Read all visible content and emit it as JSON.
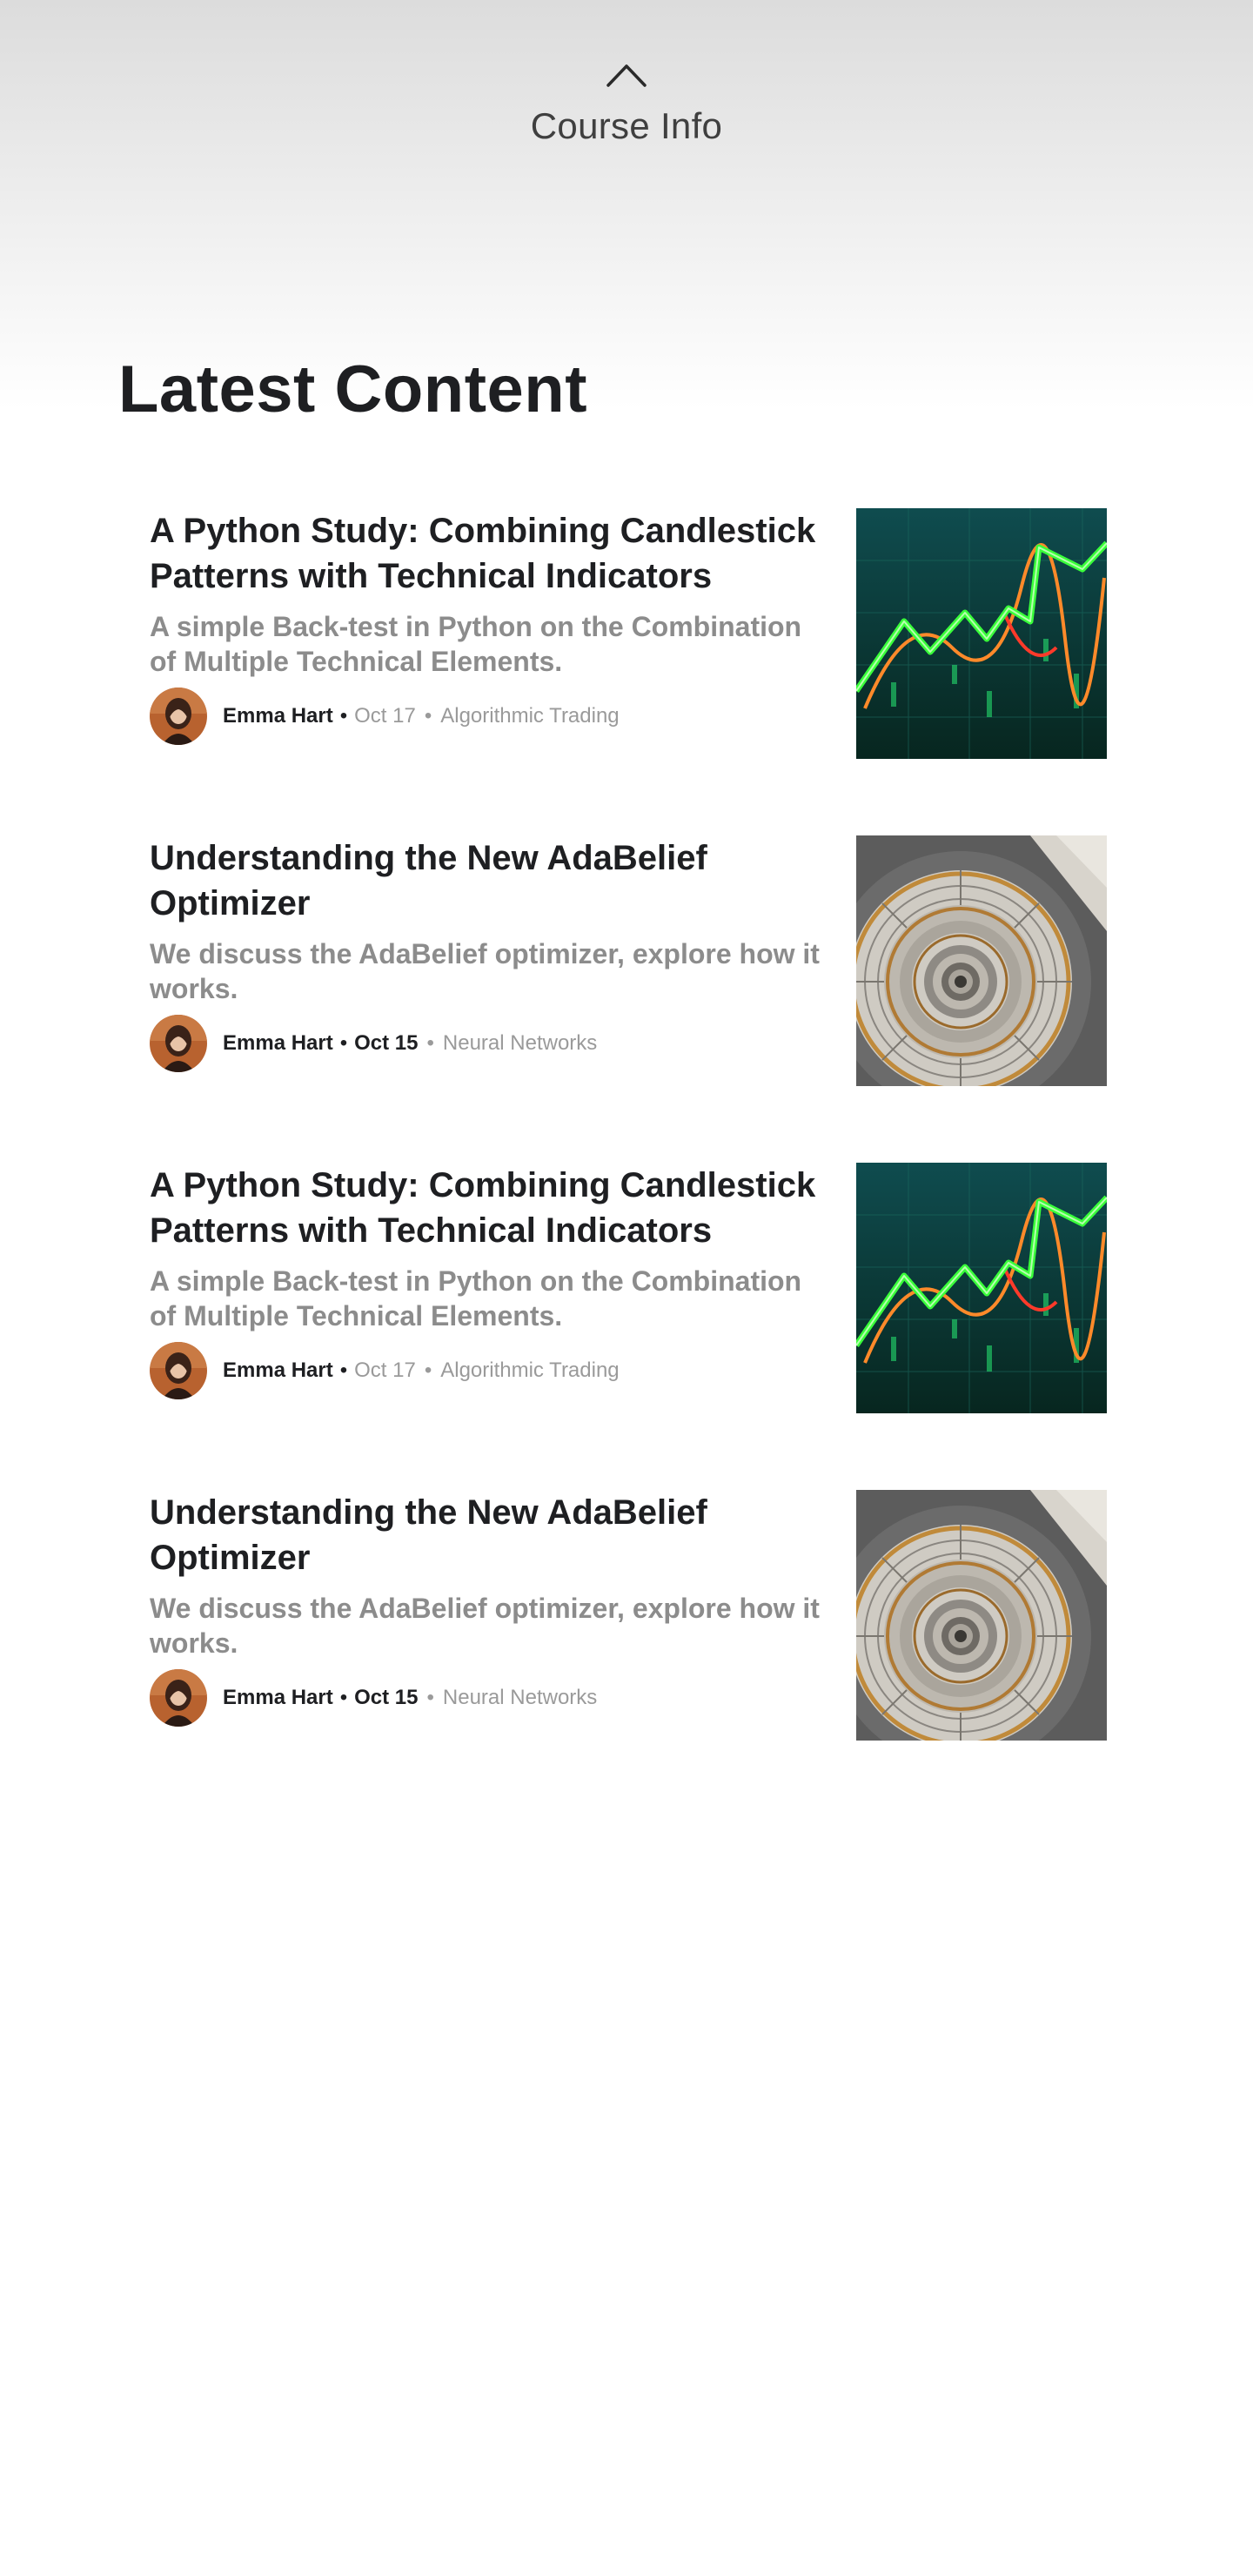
{
  "header": {
    "chevron_icon": "chevron-up-icon",
    "course_info_label": "Course Info"
  },
  "section": {
    "title": "Latest Content"
  },
  "articles": [
    {
      "title": "A Python Study: Combining Candlestick Patterns with Technical Indicators",
      "subtitle": "A simple Back-test in Python on the Combination of Multiple Technical Elements.",
      "author": "Emma Hart",
      "date": "Oct 17",
      "category": "Algorithmic Trading",
      "thumbnail": "stock-chart-thumbnail"
    },
    {
      "title": "Understanding the New AdaBelief Optimizer",
      "subtitle": "We discuss the AdaBelief optimizer, explore how it works.",
      "author": "Emma Hart",
      "date": "Oct 15",
      "category": "Neural Networks",
      "thumbnail": "spiral-staircase-thumbnail"
    },
    {
      "title": "A Python Study: Combining Candlestick Patterns with Technical Indicators",
      "subtitle": "A simple Back-test in Python on the Combination of Multiple Technical Elements.",
      "author": "Emma Hart",
      "date": "Oct 17",
      "category": "Algorithmic Trading",
      "thumbnail": "stock-chart-thumbnail"
    },
    {
      "title": "Understanding the New AdaBelief Optimizer",
      "subtitle": "We discuss the AdaBelief optimizer, explore how it works.",
      "author": "Emma Hart",
      "date": "Oct 15",
      "category": "Neural Networks",
      "thumbnail": "spiral-staircase-thumbnail"
    }
  ],
  "colors": {
    "title_text": "#1e1f22",
    "subtitle_text": "#8c8c8c",
    "meta_light": "#9a9a9a",
    "chart_green": "#39ff3a",
    "chart_red": "#ff4a2a",
    "chart_bg": "#0b3a3a"
  }
}
